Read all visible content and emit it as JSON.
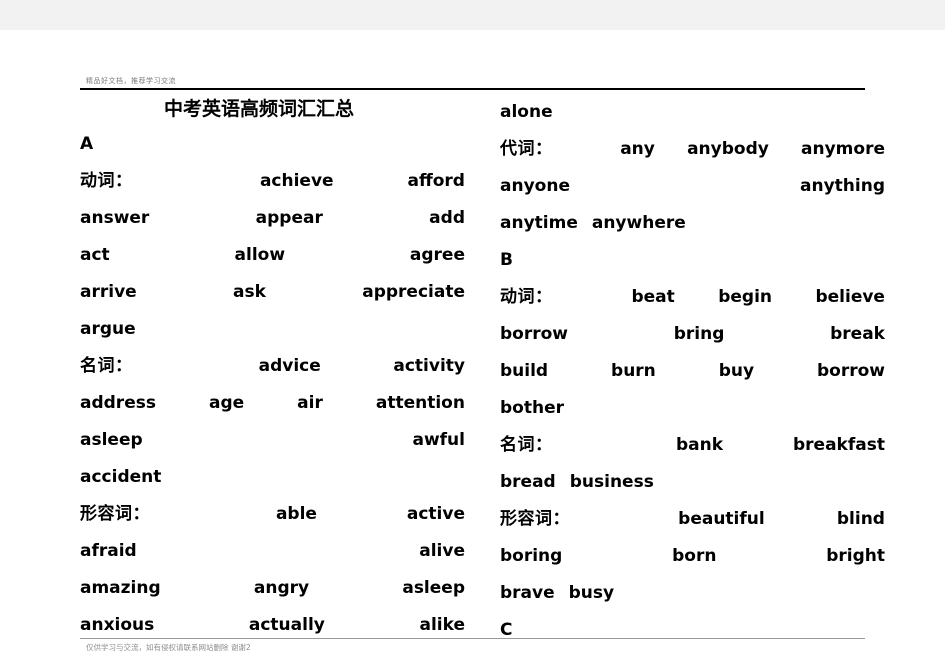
{
  "document": {
    "header_watermark": "精品好文档，推荐学习交流",
    "footer_watermark": "仅供学习与交流，如有侵权请联系网站删除  谢谢2",
    "title": "中考英语高频词汇汇总",
    "columns": [
      {
        "id": "left-column",
        "blocks": [
          {
            "type": "title",
            "text": "中考英语高频词汇汇总"
          },
          {
            "type": "letter",
            "text": "A"
          },
          {
            "type": "row",
            "pos": "动词：",
            "pos_style": "spread3",
            "align": "justify",
            "words": [
              "achieve",
              "afford"
            ]
          },
          {
            "type": "row",
            "pos": "",
            "align": "justify",
            "words": [
              "answer",
              "appear",
              "add"
            ]
          },
          {
            "type": "row",
            "pos": "",
            "align": "justify",
            "words": [
              "act",
              "allow",
              "agree"
            ]
          },
          {
            "type": "row",
            "pos": "",
            "align": "justify",
            "words": [
              "arrive",
              "ask",
              "appreciate"
            ]
          },
          {
            "type": "row",
            "pos": "",
            "align": "left",
            "words": [
              "argue"
            ]
          },
          {
            "type": "row",
            "pos": "名词：",
            "pos_style": "spread3",
            "align": "justify",
            "words": [
              "advice",
              "activity"
            ]
          },
          {
            "type": "row",
            "pos": "",
            "align": "justify",
            "words": [
              "address",
              "age",
              "air",
              "attention"
            ]
          },
          {
            "type": "row",
            "pos": "",
            "align": "justify",
            "words": [
              "asleep",
              "awful"
            ]
          },
          {
            "type": "row",
            "pos": "",
            "align": "left",
            "words": [
              "accident"
            ]
          },
          {
            "type": "row",
            "pos": "形容词：",
            "pos_style": "spread3",
            "align": "justify",
            "words": [
              "able",
              "active"
            ]
          },
          {
            "type": "row",
            "pos": "",
            "align": "justify",
            "words": [
              "afraid",
              "alive"
            ]
          },
          {
            "type": "row",
            "pos": "",
            "align": "justify",
            "words": [
              "amazing",
              "angry",
              "asleep"
            ]
          },
          {
            "type": "row",
            "pos": "",
            "align": "justify",
            "words": [
              "anxious",
              "actually",
              "alike"
            ]
          }
        ]
      },
      {
        "id": "right-column",
        "blocks": [
          {
            "type": "row",
            "pos": "",
            "align": "left",
            "words": [
              "alone"
            ]
          },
          {
            "type": "row",
            "pos": "代词：",
            "pos_style": "spread2",
            "align": "justify",
            "words": [
              "any",
              "anybody",
              "anymore"
            ]
          },
          {
            "type": "row",
            "pos": "",
            "align": "justify",
            "words": [
              "anyone",
              "anything"
            ]
          },
          {
            "type": "row",
            "pos": "",
            "align": "left",
            "words": [
              "anytime",
              "anywhere"
            ]
          },
          {
            "type": "letter",
            "text": "B"
          },
          {
            "type": "row",
            "pos": "动词：",
            "pos_style": "spread2",
            "align": "justify",
            "words": [
              "beat",
              "begin",
              "believe"
            ]
          },
          {
            "type": "row",
            "pos": "",
            "align": "justify",
            "words": [
              "borrow",
              "bring",
              "break"
            ]
          },
          {
            "type": "row",
            "pos": "",
            "align": "justify",
            "words": [
              "build",
              "burn",
              "buy",
              "borrow"
            ]
          },
          {
            "type": "row",
            "pos": "",
            "align": "left",
            "words": [
              "bother"
            ]
          },
          {
            "type": "row",
            "pos": "名词：",
            "pos_style": "spread3",
            "align": "justify",
            "words": [
              "bank",
              "breakfast"
            ]
          },
          {
            "type": "row",
            "pos": "",
            "align": "left",
            "words": [
              "bread",
              "business"
            ]
          },
          {
            "type": "row",
            "pos": "形容词：",
            "pos_style": "spread3",
            "align": "justify",
            "words": [
              "beautiful",
              "blind"
            ]
          },
          {
            "type": "row",
            "pos": "",
            "align": "justify",
            "words": [
              "boring",
              "born",
              "bright"
            ]
          },
          {
            "type": "row",
            "pos": "",
            "align": "left",
            "words": [
              "brave",
              "busy"
            ]
          },
          {
            "type": "letter",
            "text": "C"
          }
        ]
      }
    ]
  }
}
